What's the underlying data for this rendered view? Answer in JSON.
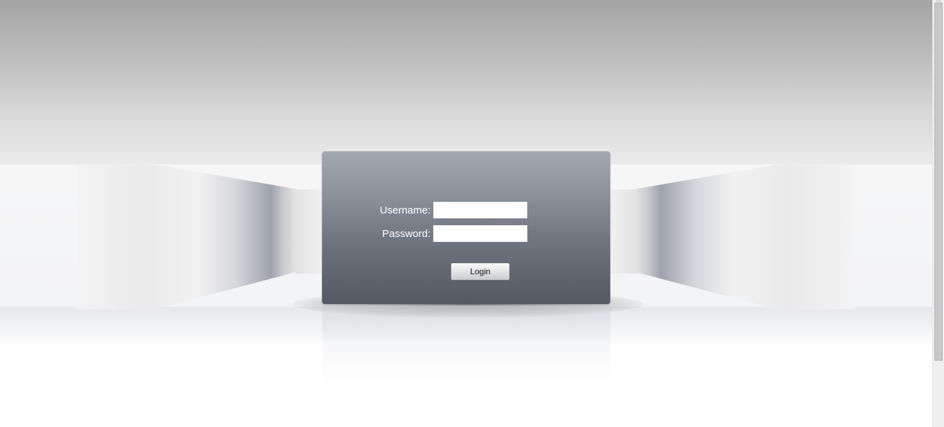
{
  "login": {
    "username_label": "Username:",
    "password_label": "Password:",
    "username_value": "",
    "password_value": "",
    "login_button_label": "Login"
  },
  "colors": {
    "panel_top": "#a3a8b0",
    "panel_bottom": "#535862",
    "label_text": "#ffffff"
  }
}
